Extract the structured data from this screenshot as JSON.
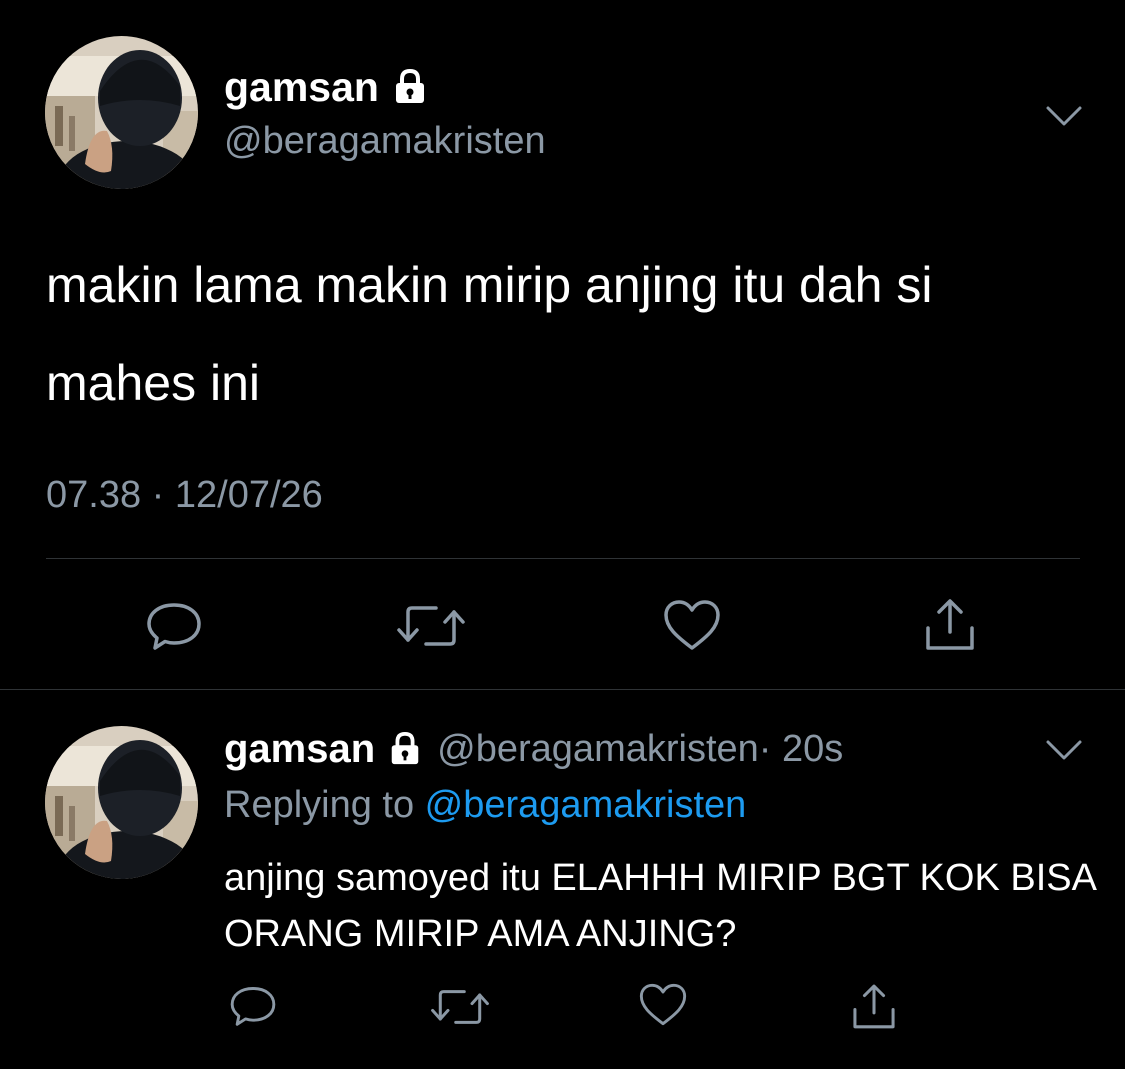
{
  "main_tweet": {
    "display_name": "gamsan",
    "handle": "@beragamakristen",
    "text": "makin lama makin mirip anjing itu dah si mahes ini",
    "timestamp": "07.38 · 12/07/26",
    "icons": {
      "verified_lock": "lock-icon",
      "menu": "chevron-down-icon",
      "reply": "comment-bubble-icon",
      "retweet": "retweet-icon",
      "like": "heart-icon",
      "share": "share-icon"
    }
  },
  "reply_tweet": {
    "display_name": "gamsan",
    "handle": "@beragamakristen",
    "time_ago": "· 20s",
    "replying_prefix": "Replying to ",
    "replying_to": "@beragamakristen",
    "text": "anjing samoyed itu ELAHHH MIRIP BGT KOK BISA ORANG MIRIP AMA ANJING?"
  },
  "colors": {
    "background": "#000000",
    "text_primary": "#ffffff",
    "text_secondary": "#8b98a5",
    "link": "#1d9bf0",
    "divider": "#2f3336"
  }
}
